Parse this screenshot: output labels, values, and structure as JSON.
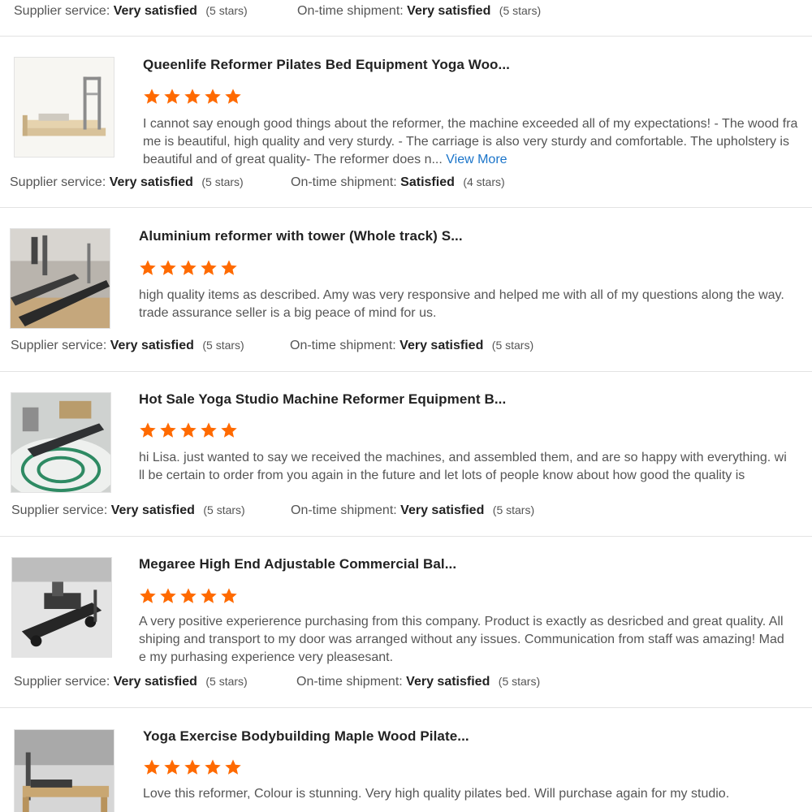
{
  "colors": {
    "accent": "#ff6a00",
    "link": "#1a74c9"
  },
  "top_ratings": {
    "supplier_label": "Supplier service:",
    "supplier_value": "Very satisfied",
    "supplier_stars": "(5 stars)",
    "shipment_label": "On-time shipment:",
    "shipment_value": "Very satisfied",
    "shipment_stars": "(5 stars)"
  },
  "reviews": [
    {
      "title": "Queenlife Reformer Pilates Bed Equipment Yoga Woo...",
      "rating": 5,
      "body": "I cannot say enough good things about the reformer, the machine exceeded all of my expectations! - The wood frame is beautiful, high quality and very sturdy. - The carriage is also very sturdy and comfortable.  The upholstery is beautiful and of great quality- The reformer does n...",
      "view_more": "View More",
      "supplier_label": "Supplier service:",
      "supplier_value": "Very satisfied",
      "supplier_stars": "(5 stars)",
      "shipment_label": "On-time shipment:",
      "shipment_value": "Satisfied",
      "shipment_stars": "(4 stars)"
    },
    {
      "title": "Aluminium reformer with tower (Whole track) S...",
      "rating": 5,
      "body": "high quality items as described. Amy was very responsive and helped me with all of my questions along the way. trade assurance seller is a big peace of mind for us.",
      "supplier_label": "Supplier service:",
      "supplier_value": "Very satisfied",
      "supplier_stars": "(5 stars)",
      "shipment_label": "On-time shipment:",
      "shipment_value": "Very satisfied",
      "shipment_stars": "(5 stars)"
    },
    {
      "title": "Hot Sale Yoga Studio Machine Reformer Equipment B...",
      "rating": 5,
      "body": "hi Lisa. just wanted to say we received the machines, and assembled them, and are so happy with everything. will be certain to order from you again in the future and let lots of people know about how good the quality is",
      "supplier_label": "Supplier service:",
      "supplier_value": "Very satisfied",
      "supplier_stars": "(5 stars)",
      "shipment_label": "On-time shipment:",
      "shipment_value": "Very satisfied",
      "shipment_stars": "(5 stars)"
    },
    {
      "title": "Megaree High End Adjustable Commercial Bal...",
      "rating": 5,
      "body": "A very positive experierence purchasing from this company. Product is exactly as desricbed and great quality. All shiping and transport to my door was arranged without any issues. Communication from staff was amazing! Made my purhasing experience very pleasesant.",
      "supplier_label": "Supplier service:",
      "supplier_value": "Very satisfied",
      "supplier_stars": "(5 stars)",
      "shipment_label": "On-time shipment:",
      "shipment_value": "Very satisfied",
      "shipment_stars": "(5 stars)"
    },
    {
      "title": "Yoga Exercise Bodybuilding Maple Wood Pilate...",
      "rating": 5,
      "body": "Love this reformer, Colour is stunning. Very high quality pilates bed. Will purchase again for my studio."
    }
  ]
}
